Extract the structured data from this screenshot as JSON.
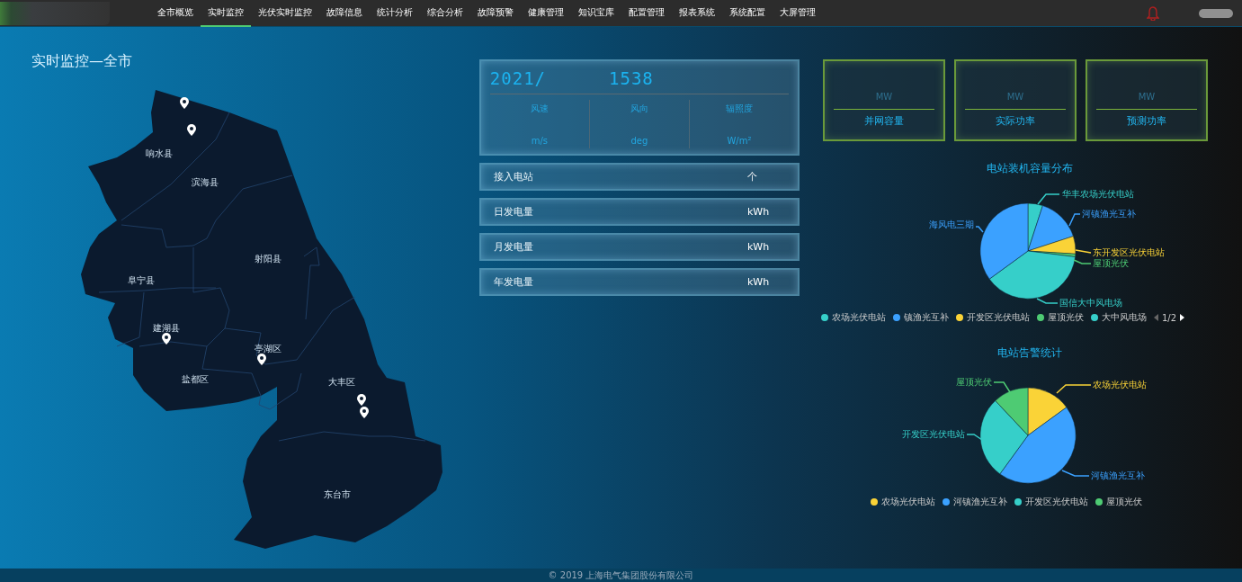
{
  "nav": {
    "items": [
      {
        "label": "全市概览",
        "selected": false
      },
      {
        "label": "实时监控",
        "selected": true
      },
      {
        "label": "光伏实时监控",
        "selected": false
      },
      {
        "label": "故障信息",
        "selected": false
      },
      {
        "label": "统计分析",
        "selected": false
      },
      {
        "label": "综合分析",
        "selected": false
      },
      {
        "label": "故障预警",
        "selected": false
      },
      {
        "label": "健康管理",
        "selected": false
      },
      {
        "label": "知识宝库",
        "selected": false
      },
      {
        "label": "配置管理",
        "selected": false
      },
      {
        "label": "报表系统",
        "selected": false
      },
      {
        "label": "系统配置",
        "selected": false
      },
      {
        "label": "大屏管理",
        "selected": false
      }
    ]
  },
  "map": {
    "title": "实时监控—全市",
    "districts": [
      "响水县",
      "滨海县",
      "射阳县",
      "阜宁县",
      "建湖县",
      "亭湖区",
      "盐都区",
      "大丰区",
      "东台市"
    ]
  },
  "clock": {
    "date": "2021/",
    "time": "1538"
  },
  "weather": [
    {
      "label": "风速",
      "unit": "m/s"
    },
    {
      "label": "风向",
      "unit": "deg"
    },
    {
      "label": "辐照度",
      "unit": "W/m²"
    }
  ],
  "stats": [
    {
      "label": "接入电站",
      "unit": "个"
    },
    {
      "label": "日发电量",
      "unit": "kWh"
    },
    {
      "label": "月发电量",
      "unit": "kWh"
    },
    {
      "label": "年发电量",
      "unit": "kWh"
    }
  ],
  "power_cards": [
    {
      "unit": "MW",
      "label": "并网容量"
    },
    {
      "unit": "MW",
      "label": "实际功率"
    },
    {
      "unit": "MW",
      "label": "预测功率"
    }
  ],
  "capacity_chart": {
    "title": "电站装机容量分布",
    "labels": [
      {
        "text": "华丰农场光伏电站",
        "color": "#36cfc9"
      },
      {
        "text": "河镇渔光互补",
        "color": "#3ba1ff"
      },
      {
        "text": "海风电三期",
        "color": "#3ba1ff"
      },
      {
        "text": "东开发区光伏电站",
        "color": "#fad337"
      },
      {
        "text": "屋顶光伏",
        "color": "#4ecb73"
      },
      {
        "text": "国信大中风电场",
        "color": "#36cfc9"
      }
    ],
    "legend": [
      {
        "text": "农场光伏电站",
        "color": "#36cfc9"
      },
      {
        "text": "镇渔光互补",
        "color": "#3ba1ff"
      },
      {
        "text": "开发区光伏电站",
        "color": "#fad337"
      },
      {
        "text": "屋顶光伏",
        "color": "#4ecb73"
      },
      {
        "text": "大中风电场",
        "color": "#36cfc9"
      }
    ],
    "pager": "1/2"
  },
  "alarm_chart": {
    "title": "电站告警统计",
    "labels": [
      {
        "text": "屋顶光伏",
        "color": "#4ecb73"
      },
      {
        "text": "农场光伏电站",
        "color": "#fad337"
      },
      {
        "text": "开发区光伏电站",
        "color": "#36cfc9"
      },
      {
        "text": "河镇渔光互补",
        "color": "#3ba1ff"
      }
    ],
    "legend": [
      {
        "text": "农场光伏电站",
        "color": "#fad337"
      },
      {
        "text": "河镇渔光互补",
        "color": "#3ba1ff"
      },
      {
        "text": "开发区光伏电站",
        "color": "#36cfc9"
      },
      {
        "text": "屋顶光伏",
        "color": "#4ecb73"
      }
    ]
  },
  "footer": "© 2019 上海电气集团股份有限公司"
}
